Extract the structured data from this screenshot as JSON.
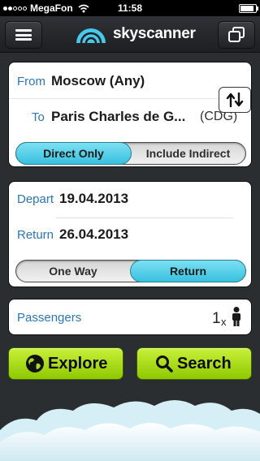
{
  "status": {
    "carrier": "MegaFon",
    "time": "11:58"
  },
  "navbar": {
    "logo_text": "skyscanner"
  },
  "route": {
    "from_label": "From",
    "from_value": "Moscow (Any)",
    "to_label": "To",
    "to_value": "Paris Charles de G...",
    "to_code": "(CDG)",
    "direct_only": "Direct Only",
    "include_indirect": "Include Indirect"
  },
  "dates": {
    "depart_label": "Depart",
    "depart_value": "19.04.2013",
    "return_label": "Return",
    "return_value": "26.04.2013",
    "one_way": "One Way",
    "return_toggle": "Return"
  },
  "passengers": {
    "label": "Passengers",
    "count": "1",
    "multiplier": "x"
  },
  "actions": {
    "explore": "Explore",
    "search": "Search"
  },
  "colors": {
    "accent": "#2a76b7",
    "toggle_active": "#37c0de",
    "action_green": "#9bd000"
  }
}
